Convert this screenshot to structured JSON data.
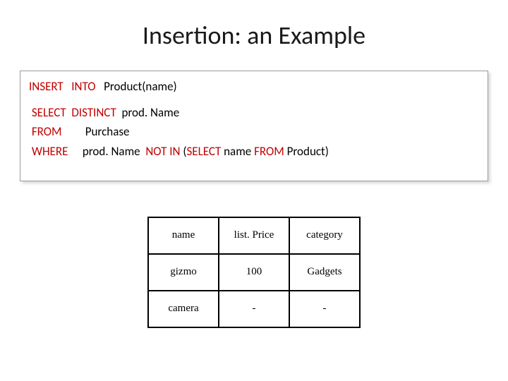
{
  "title": "Insertion: an Example",
  "code": {
    "line1_kw1": "INSERT",
    "line1_kw2": "INTO",
    "line1_rest": "Product(name)",
    "line2_kw1": "SELECT",
    "line2_kw2": "DISTINCT",
    "line2_rest": "prod. Name",
    "line3_kw": "FROM",
    "line3_rest": "Purchase",
    "line4_kw1": "WHERE",
    "line4_mid1": "prod. Name ",
    "line4_kw2": "NOT IN",
    "line4_paren": " (",
    "line4_kw3": "SELECT",
    "line4_mid2": " name ",
    "line4_kw4": "FROM",
    "line4_mid3": " Product)"
  },
  "table": {
    "headers": [
      "name",
      "list. Price",
      "category"
    ],
    "rows": [
      [
        "gizmo",
        "100",
        "Gadgets"
      ],
      [
        "camera",
        "-",
        "-"
      ]
    ]
  },
  "chart_data": {
    "type": "table",
    "title": "Insertion: an Example",
    "columns": [
      "name",
      "list. Price",
      "category"
    ],
    "rows": [
      {
        "name": "gizmo",
        "list. Price": "100",
        "category": "Gadgets"
      },
      {
        "name": "camera",
        "list. Price": "-",
        "category": "-"
      }
    ]
  }
}
